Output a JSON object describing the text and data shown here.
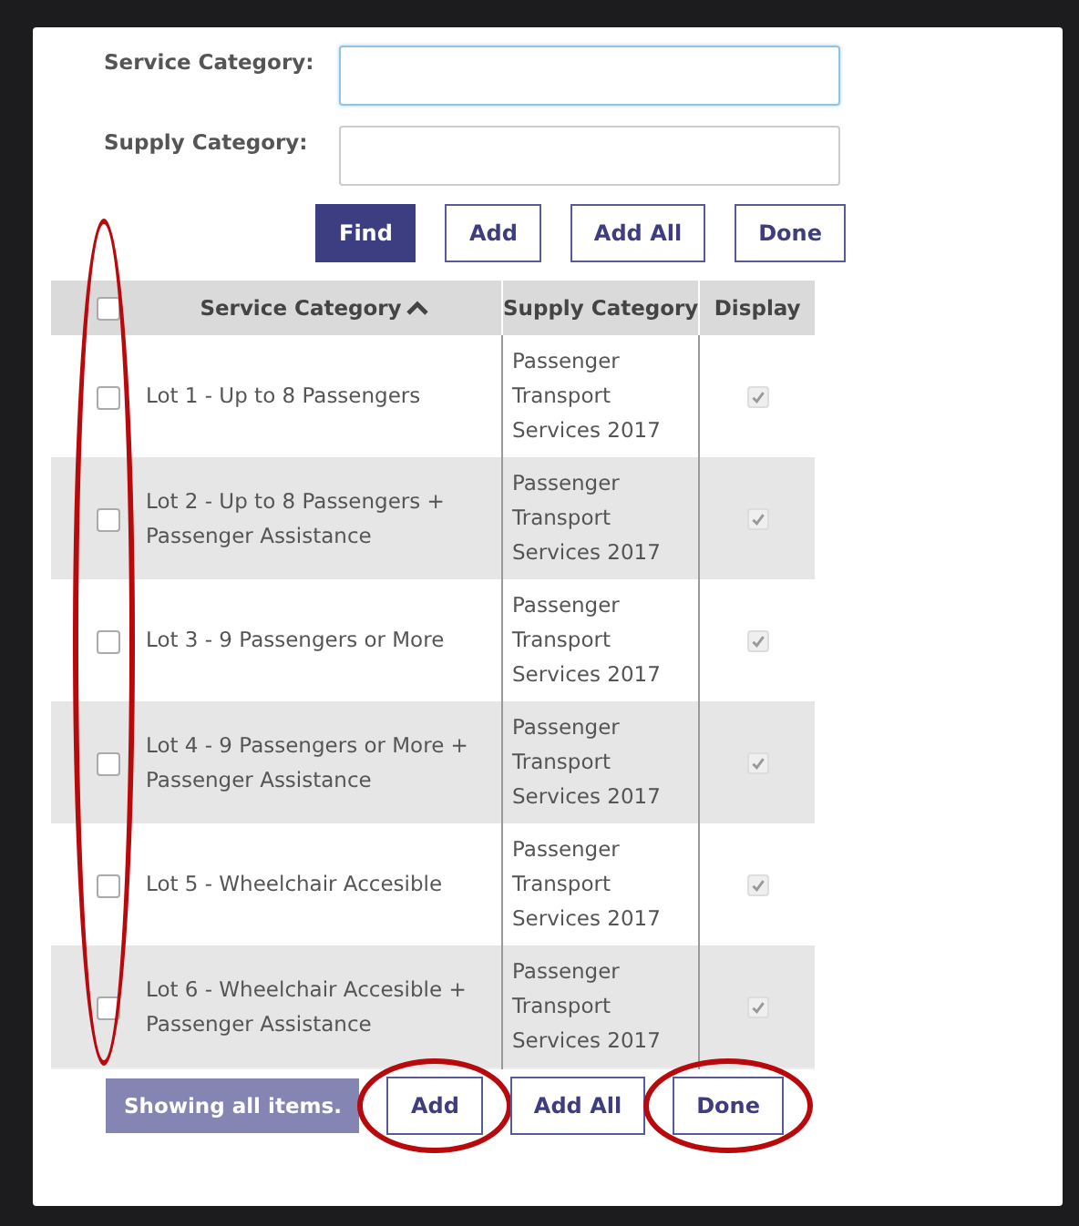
{
  "form": {
    "fields": [
      {
        "label": "Service Category:",
        "focused": true
      },
      {
        "label": "Supply Category:",
        "focused": false
      }
    ]
  },
  "top_buttons": [
    {
      "label": "Find",
      "primary": true
    },
    {
      "label": "Add",
      "primary": false
    },
    {
      "label": "Add All",
      "primary": false
    },
    {
      "label": "Done",
      "primary": false
    }
  ],
  "table": {
    "select_all_checked": false,
    "highlight_checkbox_column": true,
    "columns": [
      {
        "label": "Service Category",
        "sorted": true
      },
      {
        "label": "Supply Category",
        "sorted": false
      },
      {
        "label": "Display",
        "sorted": false
      }
    ],
    "rows": [
      {
        "checked": false,
        "service": "Lot 1 - Up to 8 Passengers",
        "supply": "Passenger Transport Services 2017",
        "display": true
      },
      {
        "checked": false,
        "service": "Lot 2 - Up to 8 Passengers + Passenger Assistance",
        "supply": "Passenger Transport Services 2017",
        "display": true
      },
      {
        "checked": false,
        "service": "Lot 3 - 9 Passengers or More",
        "supply": "Passenger Transport Services 2017",
        "display": true
      },
      {
        "checked": false,
        "service": "Lot 4 - 9 Passengers or More + Passenger Assistance",
        "supply": "Passenger Transport Services 2017",
        "display": true
      },
      {
        "checked": false,
        "service": "Lot 5 - Wheelchair Accesible",
        "supply": "Passenger Transport Services 2017",
        "display": true
      },
      {
        "checked": false,
        "service": "Lot 6 - Wheelchair Accesible + Passenger Assistance",
        "supply": "Passenger Transport Services 2017",
        "display": true
      }
    ]
  },
  "footer": {
    "status": "Showing all items.",
    "buttons": [
      {
        "label": "Add",
        "highlighted": true
      },
      {
        "label": "Add All",
        "highlighted": false
      },
      {
        "label": "Done",
        "highlighted": true
      }
    ]
  }
}
